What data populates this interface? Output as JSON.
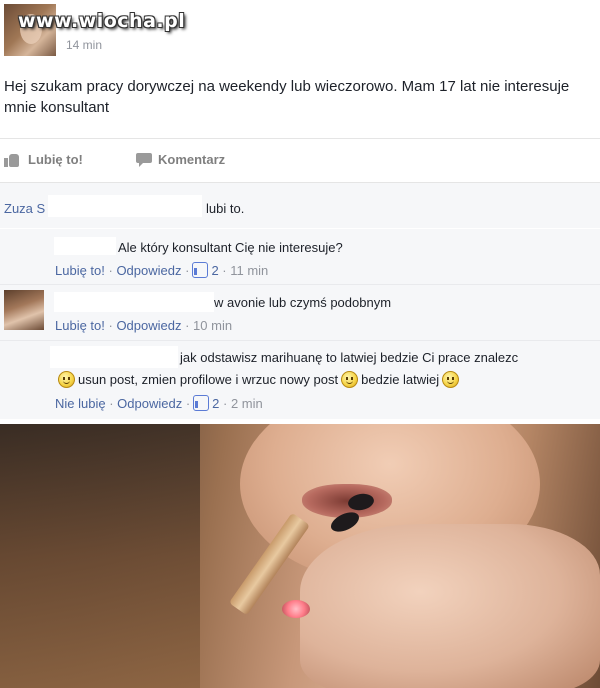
{
  "watermark": "www.wiocha.pl",
  "post": {
    "time": "14 min",
    "text": "Hej szukam pracy dorywczej na weekendy lub wieczorowo. Mam 17 lat nie interesuje mnie konsultant",
    "actions": {
      "like_label": "Lubię to!",
      "comment_label": "Komentarz"
    },
    "likes": {
      "name": "Zuza S",
      "suffix": "lubi to."
    }
  },
  "comments": [
    {
      "text": "Ale który konsultant Cię nie interesuje?",
      "like_link": "Lubię to!",
      "reply_link": "Odpowiedz",
      "like_count": "2",
      "time": "11 min"
    },
    {
      "text": "w avonie lub czymś podobnym",
      "like_link": "Lubię to!",
      "reply_link": "Odpowiedz",
      "time": "10 min"
    },
    {
      "text_line1": "jak odstawisz marihuanę to latwiej bedzie Ci prace znalezc",
      "text_line2_a": "usun post, zmien profilowe i wrzuc nowy post",
      "text_line2_b": "bedzie latwiej",
      "like_link": "Nie lubię",
      "reply_link": "Odpowiedz",
      "like_count": "2",
      "time": "2 min"
    }
  ],
  "colors": {
    "link": "#4b67a1",
    "meta": "#90949c",
    "text": "#1d2129",
    "comment_bg": "#f6f7f9"
  }
}
